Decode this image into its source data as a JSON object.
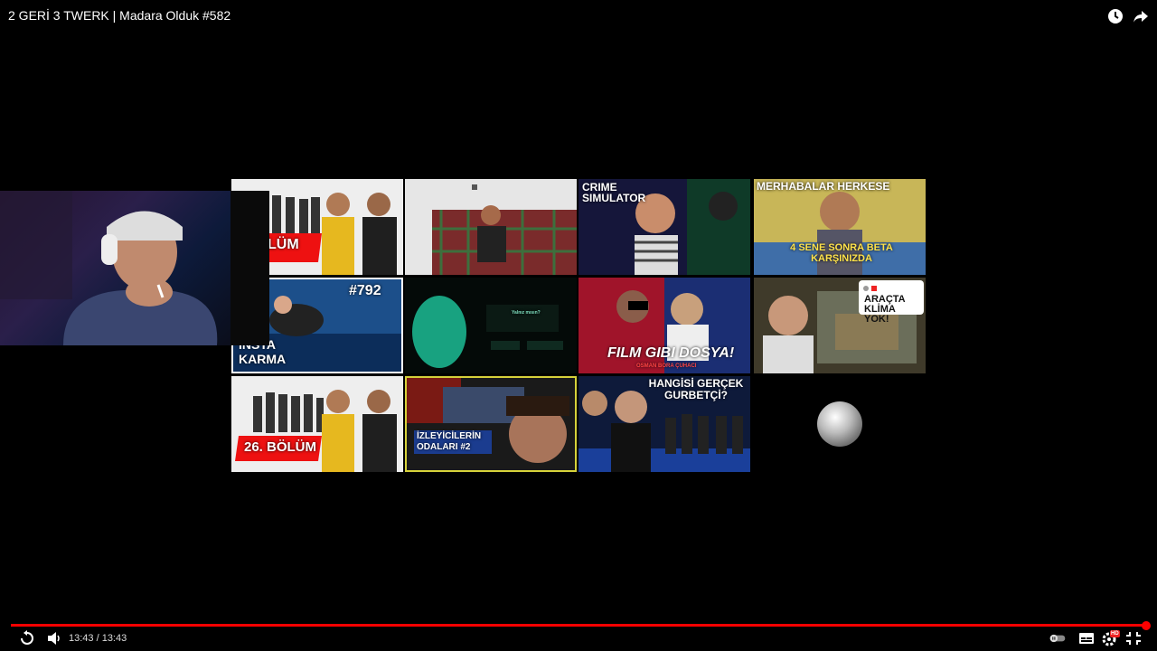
{
  "video": {
    "title": "2 GERİ 3 TWERK | Madara Olduk #582",
    "current_time": "13:43",
    "duration": "13:43",
    "time_display": "13:43 / 13:43",
    "progress": 1.0
  },
  "top_icons": [
    "watch-later-icon",
    "share-icon"
  ],
  "end_screen": {
    "tiles": [
      {
        "id": "t1",
        "text": "BÖLÜM"
      },
      {
        "id": "t2",
        "text": ""
      },
      {
        "id": "t3",
        "text": "CRIME SIMULATOR"
      },
      {
        "id": "t4",
        "text": "MERHABALAR HERKESE",
        "text2": "4 SENE SONRA BETA KARŞINIZDA"
      },
      {
        "id": "t5",
        "text": "#792",
        "text2": "INSTA KARMA"
      },
      {
        "id": "t6",
        "text": "Yalnız mısın?"
      },
      {
        "id": "t7",
        "text": "FILM GIBI DOSYA!",
        "text2": "OSMAN BORA ÇUHACI"
      },
      {
        "id": "t8",
        "text": "ARAÇTA KLİMA YOK!"
      },
      {
        "id": "t9",
        "text": "26. BÖLÜM"
      },
      {
        "id": "t10",
        "text": "İZLEYİCİLERİN ODALARI #2"
      },
      {
        "id": "t11",
        "text": "HANGİSİ GERÇEK GURBETÇİ?"
      }
    ]
  },
  "controls": {
    "icons": [
      "replay-icon",
      "volume-icon",
      "autoplay-toggle",
      "subtitles-icon",
      "settings-icon",
      "exit-fullscreen-icon"
    ],
    "settings_badge": "HD"
  },
  "colors": {
    "accent": "#ff0000",
    "background": "#000000"
  }
}
